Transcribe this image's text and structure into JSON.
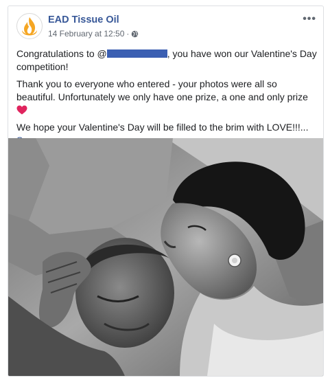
{
  "post": {
    "page_name": "EAD Tissue Oil",
    "timestamp": "14 February at 12:50",
    "separator": "·",
    "privacy_icon": "globe-icon",
    "more_label": "•••",
    "line1_prefix": "Congratulations to @",
    "line1_suffix": ", you have won our Valentine's Day competition!",
    "para2": "Thank you to everyone who entered - your photos were all so beautiful. Unfortunately we only have one prize, a one and only prize",
    "para3": "We hope your Valentine's Day will be filled to the brim with LOVE!!!...",
    "see_more": "See more",
    "heart_icon": "red-heart-icon"
  },
  "colors": {
    "link": "#385898",
    "redaction": "#3b5fb2",
    "heart": "#e0245e",
    "logo_flame": "#f5a623"
  }
}
